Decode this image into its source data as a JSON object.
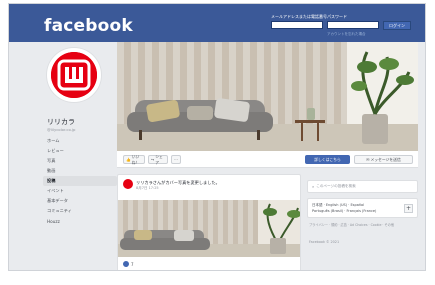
{
  "topbar": {
    "logo": "facebook",
    "email_label": "メールアドレスまたは電話番号",
    "password_label": "パスワード",
    "login_button": "ログイン",
    "forgot_link": "アカウントを忘れた場合"
  },
  "page": {
    "name": "リリカラ",
    "handle": "@lilycolor.co.jp",
    "nav": [
      {
        "label": "ホーム"
      },
      {
        "label": "レビュー"
      },
      {
        "label": "写真"
      },
      {
        "label": "動画"
      },
      {
        "label": "投稿"
      },
      {
        "label": "イベント"
      },
      {
        "label": "基本データ"
      },
      {
        "label": "コミュニティ"
      },
      {
        "label": "Houzz"
      }
    ]
  },
  "actions": {
    "like": "いいね！",
    "share": "シェア",
    "more": "···",
    "signup": "詳しくはこちら",
    "message": "メッセージを送信"
  },
  "post": {
    "title": "リリカラさんがカバー写真を変更しました。",
    "time": "8月7日 17:25",
    "reactions": "7"
  },
  "sidebar": {
    "search_placeholder": "このページの投稿を検索",
    "lang_line1": "日本語 · English (US) · Español",
    "lang_line2": "Português (Brasil) · Français (France)",
    "lang_plus": "+",
    "footer_links": "プライバシー · 規約 · 広告 · Ad Choices · Cookie · その他",
    "copyright": "Facebook © 2021"
  },
  "colors": {
    "brand": "#3b5998",
    "accent": "#4267b2",
    "logo_red": "#e60012"
  }
}
